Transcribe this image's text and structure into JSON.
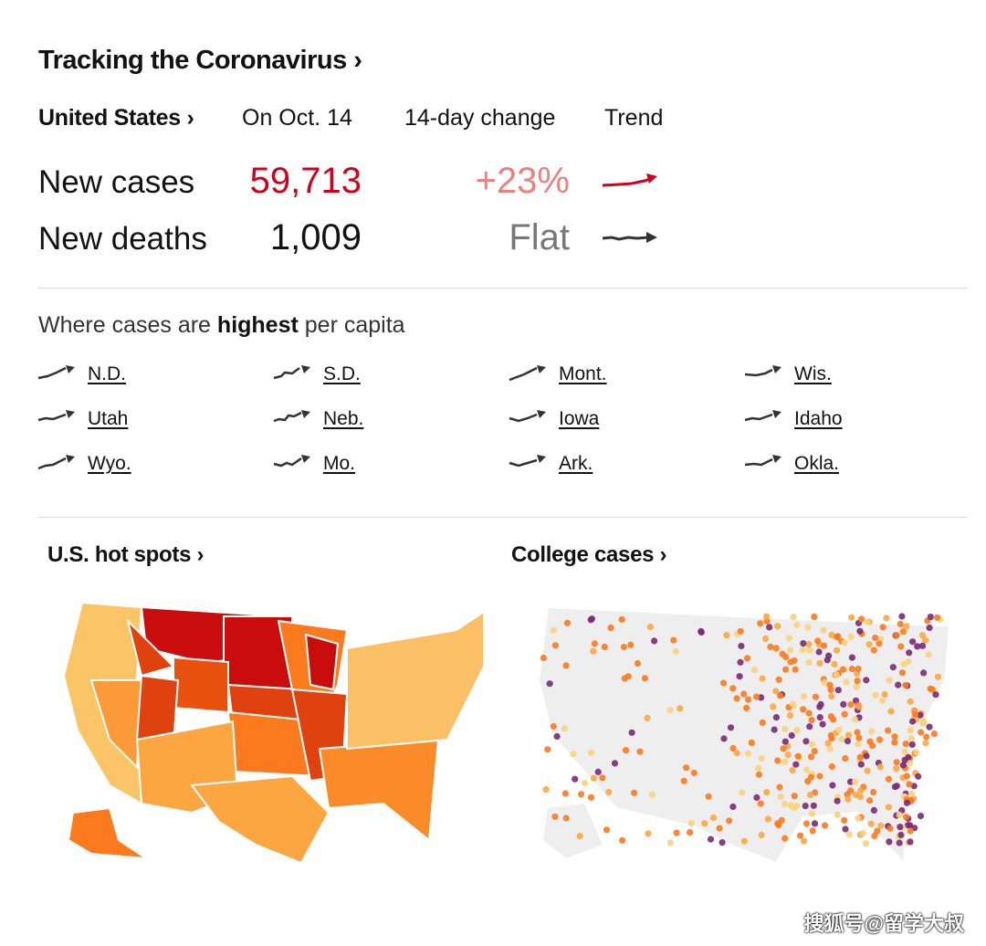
{
  "title": "Tracking the Coronavirus ›",
  "header": {
    "region": "United States ›",
    "date_col": "On Oct. 14",
    "change_col": "14-day change",
    "trend_col": "Trend"
  },
  "rows": [
    {
      "label": "New cases",
      "value": "59,713",
      "change": "+23%",
      "trend": "rising",
      "value_color": "#d0021b",
      "change_color": "#e8817f",
      "trend_color": "#d0021b"
    },
    {
      "label": "New deaths",
      "value": "1,009",
      "change": "Flat",
      "trend": "flat",
      "value_color": "#121212",
      "change_color": "#777777",
      "trend_color": "#333333"
    }
  ],
  "highest": {
    "prefix": "Where cases are ",
    "bold": "highest",
    "suffix": " per capita",
    "states": [
      "N.D.",
      "S.D.",
      "Mont.",
      "Wis.",
      "Utah",
      "Neb.",
      "Iowa",
      "Idaho",
      "Wyo.",
      "Mo.",
      "Ark.",
      "Okla."
    ]
  },
  "maps": {
    "hotspots_title": "U.S. hot spots ›",
    "college_title": "College cases ›"
  },
  "colors": {
    "dark_red": "#c90d0d",
    "red_orange": "#e0420f",
    "orange": "#fb7a1e",
    "light_orange": "#fca642",
    "pale": "#f8d27b",
    "purple": "#7b2a73"
  },
  "watermark": "搜狐号@留学大叔"
}
